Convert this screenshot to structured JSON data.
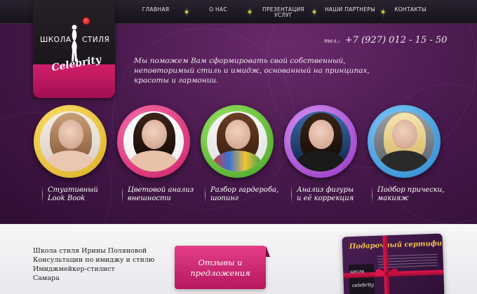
{
  "nav": {
    "items": [
      {
        "label": "Главная"
      },
      {
        "label": "О нас"
      },
      {
        "label": "Презентация услуг"
      },
      {
        "label": "Наши партнеры"
      },
      {
        "label": "Контакты"
      }
    ]
  },
  "logo": {
    "word_left": "ШКОЛА",
    "word_right": "СТИЛЯ",
    "script": "Celebrity"
  },
  "phone": {
    "prefix": "тел.:",
    "number": "+7 (927) 012 - 15 - 50"
  },
  "intro": "Мы  поможем Вам сформировать свой собственный, неповторимый стиль и имидж, основанный на принципах, красоты и гармонии.",
  "services": [
    {
      "line1": "Стуативный",
      "line2": "Look Book",
      "ring_color": "#f3d23a"
    },
    {
      "line1": "Цветовой анализ",
      "line2": "внешности",
      "ring_color": "#e8337f"
    },
    {
      "line1": "Разбор гардероба,",
      "line2": "шопинг",
      "ring_color": "#6cc23b"
    },
    {
      "line1": "Анализ фигуры",
      "line2": "и её коррекция",
      "ring_color": "#b04bd8"
    },
    {
      "line1": "Подбор прически,",
      "line2": "макияж",
      "ring_color": "#3aa4e6"
    }
  ],
  "footer": {
    "address": [
      "Школа стиля Ирины Поляновой",
      "Консультации по имиджу и стилю",
      "Имиджмейкер-стилист",
      "Самара"
    ],
    "reviews_line1": "Отзывы и",
    "reviews_line2": "предложения",
    "certificate_title": "Подарочный сертификат",
    "certificate_logo_word": "ШКОЛА  СТИЛЯ",
    "certificate_logo_script": "celebrity"
  },
  "colors": {
    "accent": "#c71a66",
    "nav_dot": "#b9d24a",
    "background": "#4a1a4e"
  }
}
